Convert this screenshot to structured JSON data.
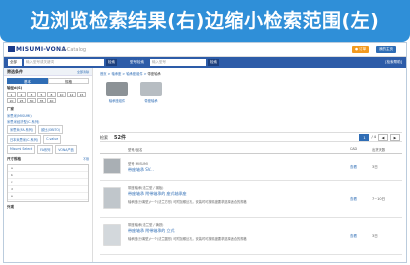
{
  "banner": {
    "title": "边浏览检索结果(右)边缩小检索范围(左)",
    "color": "#2f8fd8"
  },
  "header": {
    "logo": "MISUMI-VONA",
    "brand": "e-Catalog",
    "btn_orange": "● 订单",
    "btn_blue": "我的主页"
  },
  "search": {
    "select1": "全部",
    "input1": "输入型号或关键词",
    "btn1": "检索",
    "label2": "型号检索",
    "input2": "输入型号",
    "btn2": "检索",
    "right": "[检索帮助]"
  },
  "sidebar": {
    "head": "筛选条件",
    "head_link": "全部清除",
    "tabs": [
      "基本",
      "规格"
    ],
    "size_title": "轴径d(S)",
    "chips": [
      "1",
      "2",
      "3",
      "5",
      "8",
      "10",
      "12",
      "15",
      "20",
      "25",
      "30",
      "35",
      "40"
    ],
    "maker_title": "厂家",
    "maker_links": [
      "米思米(MISUMI)",
      "米思米经济型(C-系列)"
    ],
    "maker_pairs": [
      [
        "米思米(FA-系列)",
        "欧比(OBITO)"
      ],
      [
        "日本米思米(C-系列)",
        "C-value"
      ]
    ],
    "maker_extra": [
      "Misumi Select",
      "FA系列",
      "VONA产品"
    ],
    "spec_title": "尺寸规格",
    "spec_right": "不限",
    "spec_rows": [
      "a",
      "b",
      "c",
      "d",
      "e"
    ],
    "more_title": "外观"
  },
  "main": {
    "crumb": [
      "首页",
      "轴承座",
      "轴承座组件",
      "带座轴承"
    ],
    "products": [
      {
        "caption": "轴承座组件",
        "color": "#8c9296"
      },
      {
        "caption": "带座轴承",
        "color": "#b7bdc2"
      }
    ],
    "results_label": "检索",
    "results_count": "52件",
    "pager": {
      "current": "1",
      "total": "/ 4",
      "prev": "◀",
      "next": "▶"
    },
    "table_headers": {
      "name": "型号/品名",
      "action": "CAD",
      "days": "出货天数"
    },
    "rows": [
      {
        "code": "型号 MISUMI",
        "name": "带座轴承 SV...",
        "desc": "",
        "action": "查看",
        "days": "3日"
      },
      {
        "code": "带座轴承(法兰型 / 钢板)",
        "name": "带座轴承 附带轴承的 座式轴承座",
        "desc": "轴承座(分离型)/一个(法兰方形) 可附加螺丝孔，安装时可按精度要求选择适合的规格",
        "action": "查看",
        "days": "7~10日"
      },
      {
        "code": "带座轴承(法兰型 / 铸铁)",
        "name": "带座轴承 附带轴承的 立式",
        "desc": "轴承座(分离型)/一个(法兰圆形) 可附加螺丝孔，安装时可按精度要求选择适合的规格",
        "action": "查看",
        "days": "3日"
      }
    ]
  }
}
